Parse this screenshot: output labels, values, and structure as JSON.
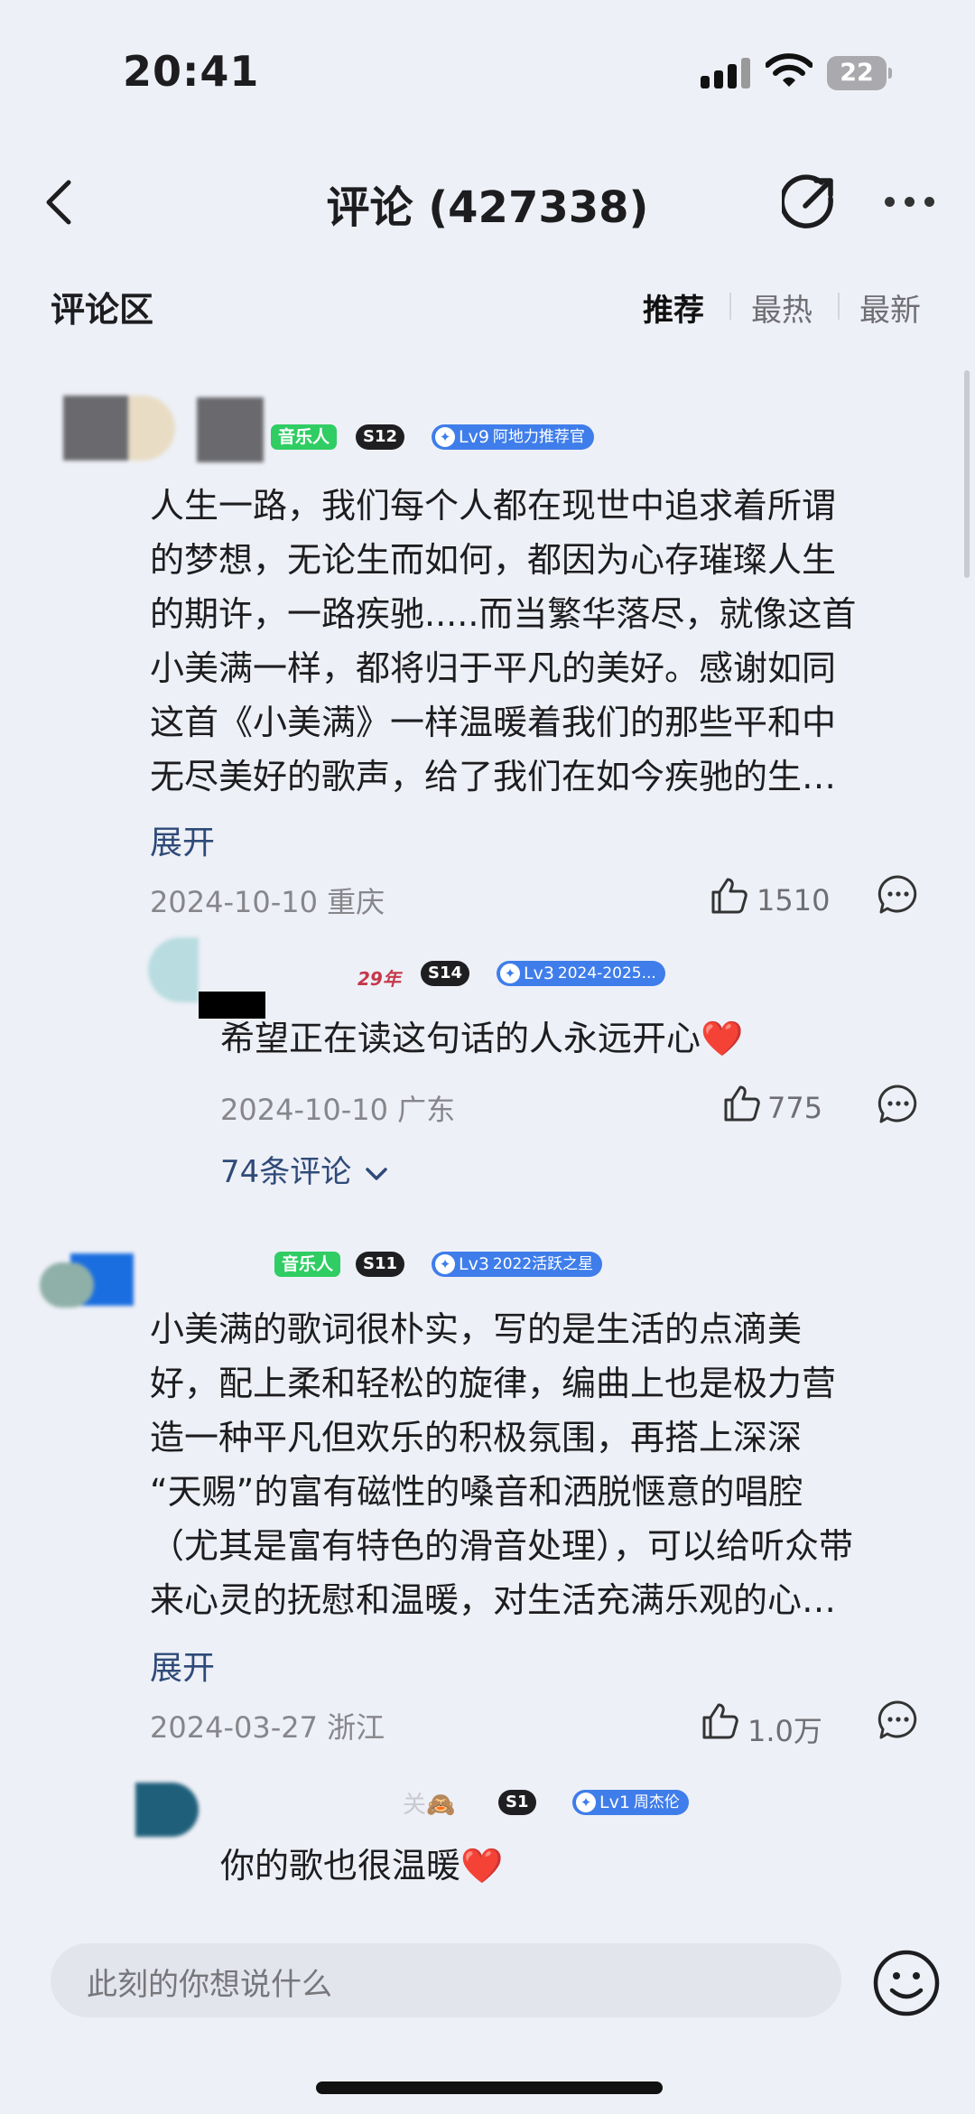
{
  "status_bar": {
    "time": "20:41",
    "battery": "22"
  },
  "nav": {
    "title": "评论 (427338)"
  },
  "section": {
    "title": "评论区",
    "sort_tabs": [
      "推荐",
      "最热",
      "最新"
    ],
    "active_tab": "推荐"
  },
  "comments": [
    {
      "badges": {
        "music": "音乐人",
        "vip": "S12",
        "level": "Lv9",
        "level_title": "阿地力推荐官"
      },
      "text": "人生一路，我们每个人都在现世中追求着所谓的梦想，无论生而如何，都因为心存璀璨人生的期许，一路疾驰.....而当繁华落尽，就像这首小美满一样，都将归于平凡的美好。感谢如同这首《小美满》一样温暖着我们的那些平和中无尽美好的歌声，给了我们在如今疾驰的生…",
      "lines": [
        "人生一路，我们每个人都在现世中追求着所谓",
        "的梦想，无论生而如何，都因为心存璀璨人生",
        "的期许，一路疾驰.....而当繁华落尽，就像这首",
        "小美满一样，都将归于平凡的美好。感谢如同",
        "这首《小美满》一样温暖着我们的那些平和中",
        "无尽美好的歌声，给了我们在如今疾驰的生…"
      ],
      "expand": "展开",
      "meta": "2024-10-10 重庆",
      "likes": "1510",
      "reply": {
        "name_fragment": "29年",
        "badges": {
          "vip": "S14",
          "level": "Lv3",
          "level_title": "2024-2025..."
        },
        "text": "希望正在读这句话的人永远开心❤️",
        "meta": "2024-10-10 广东",
        "likes": "775"
      },
      "reply_count": "74条评论"
    },
    {
      "badges": {
        "music": "音乐人",
        "vip": "S11",
        "level": "Lv3",
        "level_title": "2022活跃之星"
      },
      "lines": [
        "小美满的歌词很朴实，写的是生活的点滴美",
        "好，配上柔和轻松的旋律，编曲上也是极力营",
        "造一种平凡但欢乐的积极氛围，再搭上深深",
        "“天赐”的富有磁性的嗓音和洒脱惬意的唱腔",
        "（尤其是富有特色的滑音处理），可以给听众带",
        "来心灵的抚慰和温暖，对生活充满乐观的心…"
      ],
      "expand": "展开",
      "meta": "2024-03-27 浙江",
      "likes": "1.0万",
      "reply": {
        "name_fragment": "关🙈",
        "badges": {
          "vip": "S1",
          "level": "Lv1",
          "level_title": "周杰伦"
        },
        "text": "你的歌也很温暖❤️"
      }
    }
  ],
  "input": {
    "placeholder": "此刻的你想说什么"
  },
  "colors": {
    "background": "#eef0f7",
    "music_badge": "#2fcd63",
    "level_badge": "#3f7dea",
    "link": "#2e4a78"
  }
}
